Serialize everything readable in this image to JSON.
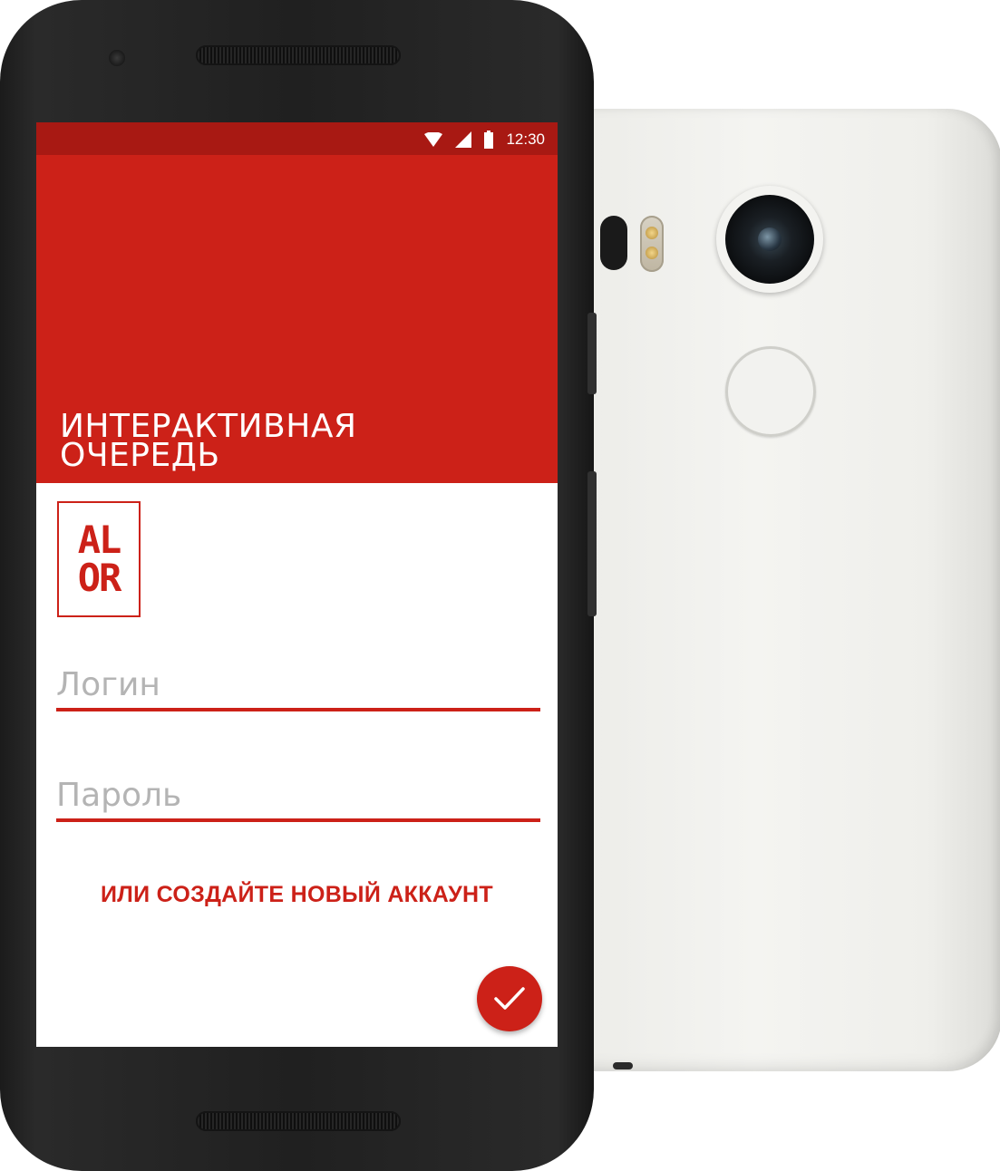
{
  "status_bar": {
    "time": "12:30",
    "icons": [
      "wifi-icon",
      "signal-icon",
      "battery-icon"
    ]
  },
  "header": {
    "title_line1": "ИНТЕРАКТИВНАЯ",
    "title_line2": "ОЧЕРЕДЬ"
  },
  "logo": {
    "line1": "AL",
    "line2": "OR"
  },
  "login_form": {
    "login_placeholder": "Логин",
    "login_value": "",
    "password_placeholder": "Пароль",
    "password_value": ""
  },
  "create_account_link": "ИЛИ СОЗДАЙТЕ НОВЫЙ АККАУНТ",
  "submit_button": {
    "icon": "checkmark-icon"
  },
  "colors": {
    "primary": "#cc2118",
    "primary_dark": "#a81913",
    "background": "#ffffff",
    "hint_text": "#b4b4b4"
  }
}
